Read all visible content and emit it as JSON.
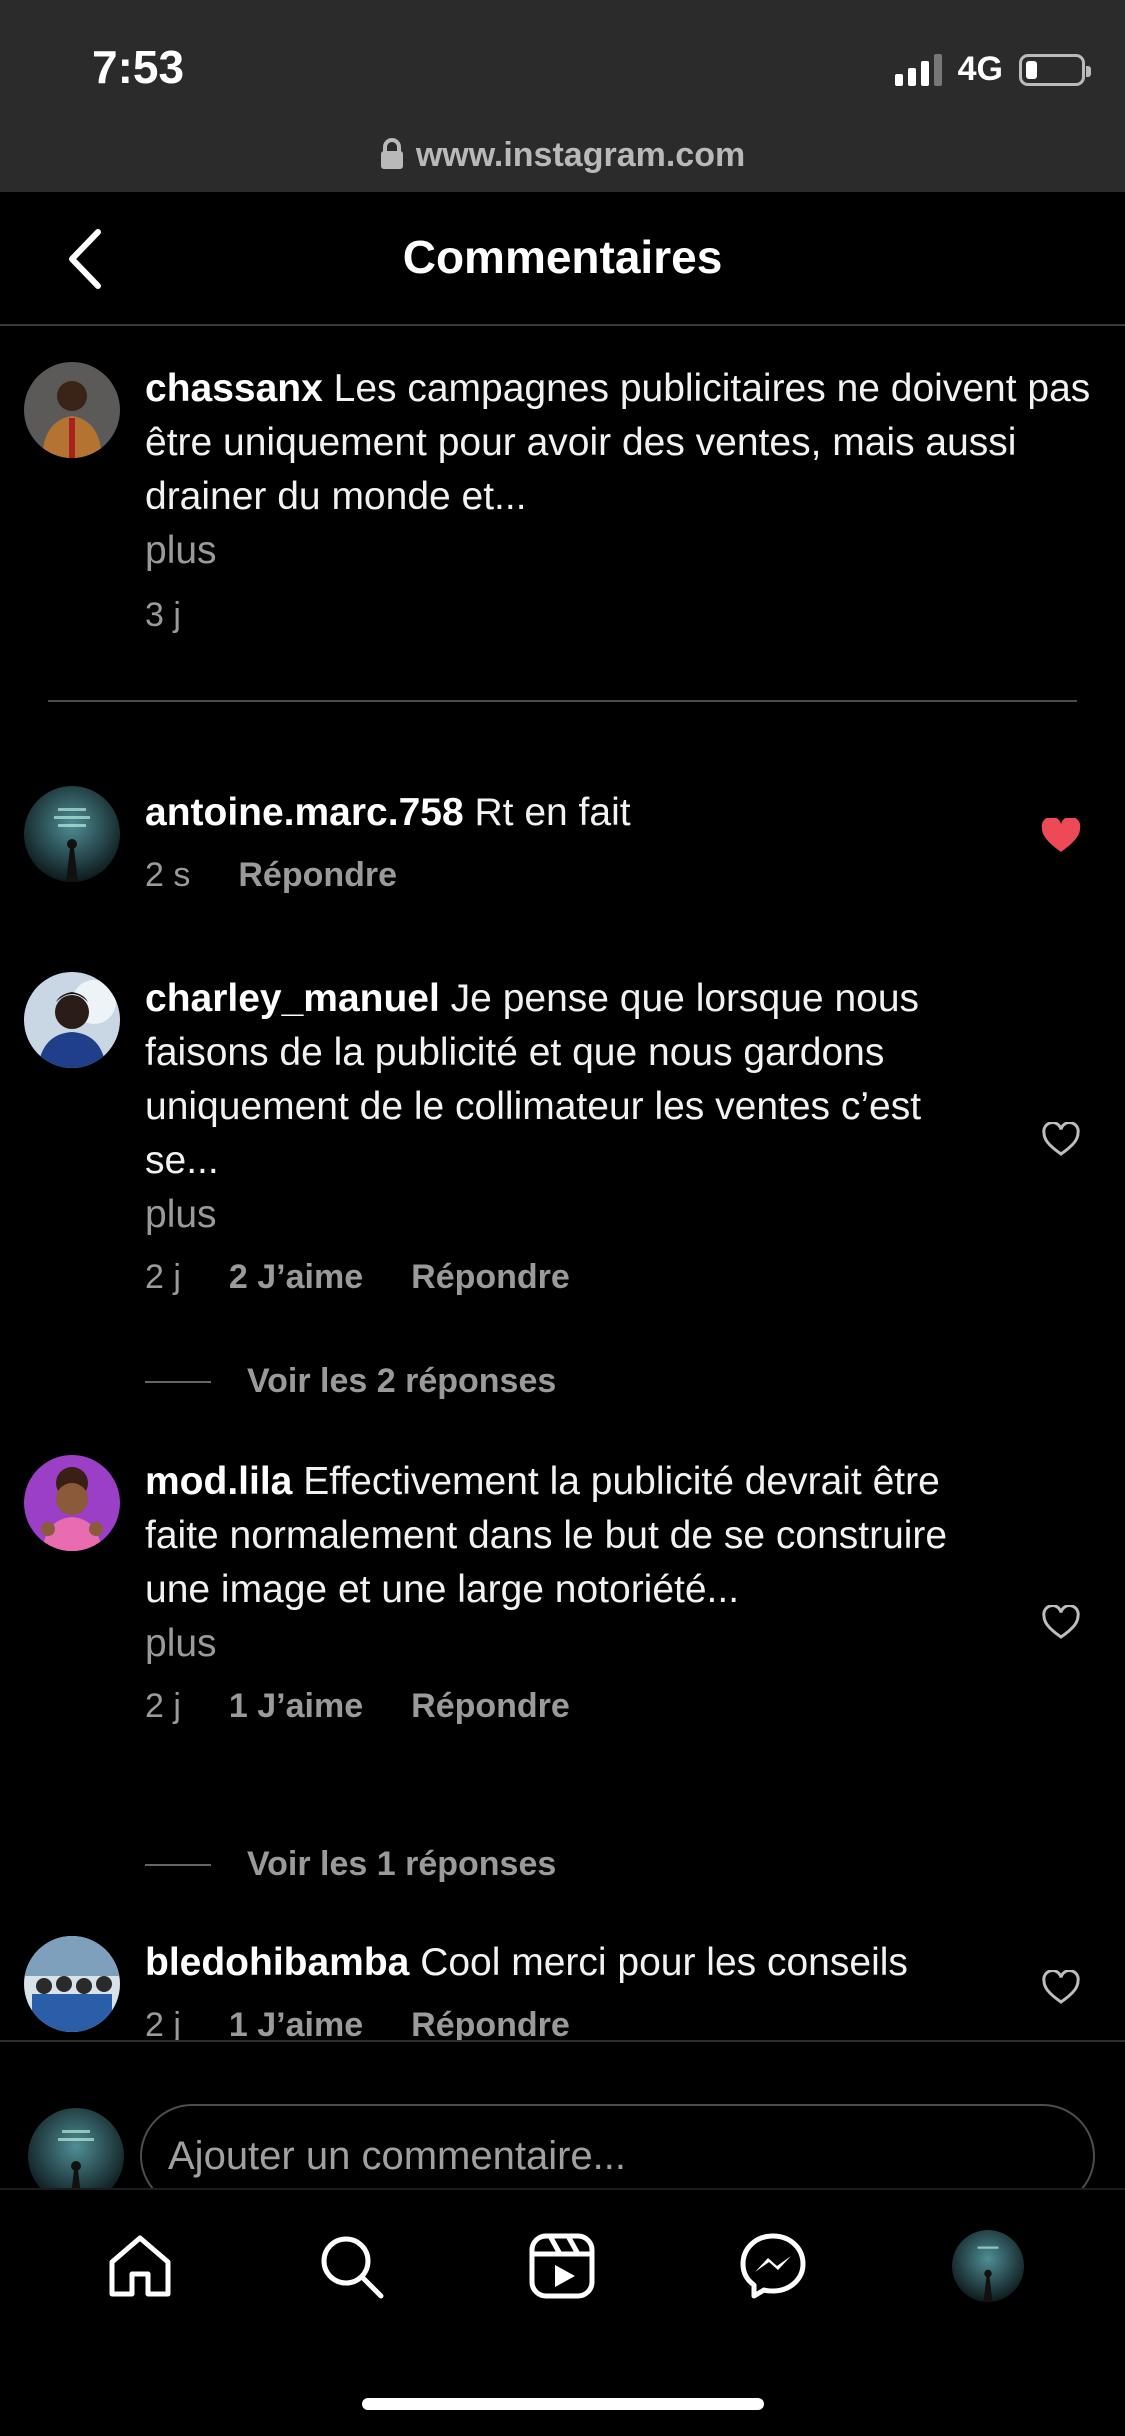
{
  "status_bar": {
    "time": "7:53",
    "network": "4G",
    "battery_level": 0.2
  },
  "browser": {
    "url": "www.instagram.com"
  },
  "header": {
    "title": "Commentaires"
  },
  "caption": {
    "username": "chassanx",
    "text": "Les campagnes publicitaires ne doivent pas être uniquement pour avoir des ventes, mais aussi drainer du monde et...",
    "more_label": "plus",
    "time": "3 j"
  },
  "comments": [
    {
      "username": "antoine.marc.758",
      "text": "Rt en fait",
      "time": "2 s",
      "likes_label": "",
      "reply_label": "Répondre",
      "liked": true
    },
    {
      "username": "charley_manuel",
      "text": "Je pense que lorsque nous faisons de la publicité et que nous gardons uniquement de le collimateur les ventes c’est se...",
      "more_label": "plus",
      "time": "2 j",
      "likes_label": "2 J’aime",
      "reply_label": "Répondre",
      "view_replies_label": "Voir les 2 réponses",
      "liked": false
    },
    {
      "username": "mod.lila",
      "text": "Effectivement la publicité devrait être faite normalement dans le but de se construire une image et une large notoriété...",
      "more_label": "plus",
      "time": "2 j",
      "likes_label": "1 J’aime",
      "reply_label": "Répondre",
      "view_replies_label": "Voir les 1 réponses",
      "liked": false
    },
    {
      "username": "bledohibamba",
      "text": "Cool merci pour les conseils",
      "time": "2 j",
      "likes_label": "1 J’aime",
      "reply_label": "Répondre",
      "liked": false
    }
  ],
  "input": {
    "placeholder": "Ajouter un commentaire..."
  },
  "colors": {
    "background": "#000000",
    "browser_bar": "#2b2b2b",
    "liked_heart": "#ed4956",
    "secondary_text": "#9a9a9a"
  },
  "icons": {
    "back": "chevron-left-icon",
    "lock": "lock-icon",
    "home": "home-icon",
    "search": "search-icon",
    "reels": "reels-icon",
    "messenger": "messenger-icon",
    "profile": "profile-avatar"
  }
}
